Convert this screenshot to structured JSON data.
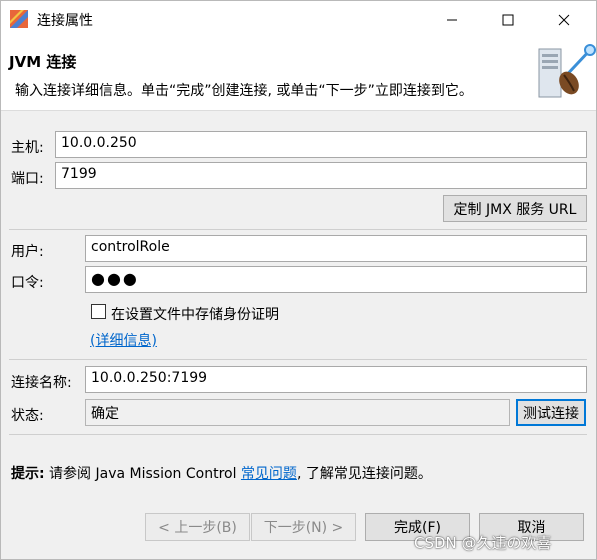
{
  "window": {
    "title": "连接属性"
  },
  "banner": {
    "title": "JVM 连接",
    "description": "输入连接详细信息。单击“完成”创建连接, 或单击“下一步”立即连接到它。"
  },
  "host": {
    "label": "主机:",
    "value": "10.0.0.250"
  },
  "port": {
    "label": "端口:",
    "value": "7199"
  },
  "jmx_button": "定制 JMX 服务 URL",
  "user": {
    "label": "用户:",
    "value": "controlRole"
  },
  "password": {
    "label": "口令:",
    "value": "●●●"
  },
  "save_credentials": {
    "label": "在设置文件中存储身份证明",
    "checked": false
  },
  "details_link": "(详细信息)",
  "connection_name": {
    "label": "连接名称:",
    "value": "10.0.0.250:7199"
  },
  "status": {
    "label": "状态:",
    "value": "确定"
  },
  "test_button": "测试连接",
  "hint": {
    "prefix": "提示:",
    "text_before": " 请参阅 Java Mission Control ",
    "link": "常见问题",
    "text_after": ", 了解常见连接问题。"
  },
  "footer": {
    "back": "< 上一步(B)",
    "next": "下一步(N) >",
    "finish": "完成(F)",
    "cancel": "取消"
  },
  "watermark": "CSDN @久违の欢喜"
}
